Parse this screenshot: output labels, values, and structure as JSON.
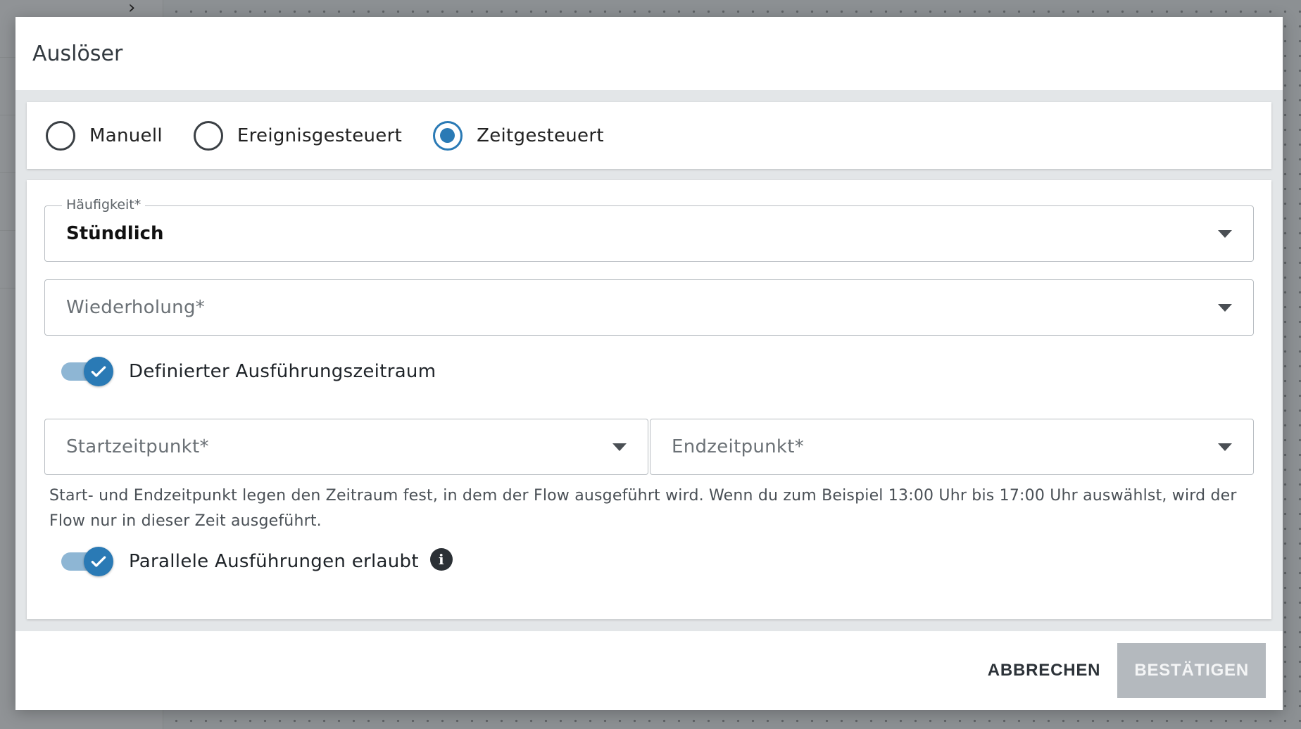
{
  "dialog": {
    "title": "Auslöser"
  },
  "trigger_types": [
    {
      "label": "Manuell",
      "selected": false
    },
    {
      "label": "Ereignisgesteuert",
      "selected": false
    },
    {
      "label": "Zeitgesteuert",
      "selected": true
    }
  ],
  "form": {
    "frequency": {
      "label": "Häufigkeit*",
      "value": "Stündlich"
    },
    "repetition": {
      "placeholder": "Wiederholung*"
    },
    "defined_period_toggle": {
      "label": "Definierter Ausführungszeitraum",
      "on": true
    },
    "start_time": {
      "placeholder": "Startzeitpunkt*"
    },
    "end_time": {
      "placeholder": "Endzeitpunkt*"
    },
    "help_text": "Start- und Endzeitpunkt legen den Zeitraum fest, in dem der Flow ausgeführt wird. Wenn du zum Beispiel 13:00 Uhr bis 17:00 Uhr auswählst, wird der Flow nur in dieser Zeit ausgeführt.",
    "parallel_toggle": {
      "label": "Parallele Ausführungen erlaubt",
      "on": true
    },
    "info_icon_glyph": "i"
  },
  "footer": {
    "cancel_label": "ABBRECHEN",
    "confirm_label": "BESTÄTIGEN"
  },
  "colors": {
    "accent": "#2a7ab5",
    "toggle_track": "#8eb6d4",
    "disabled_button": "#b4b9be"
  }
}
